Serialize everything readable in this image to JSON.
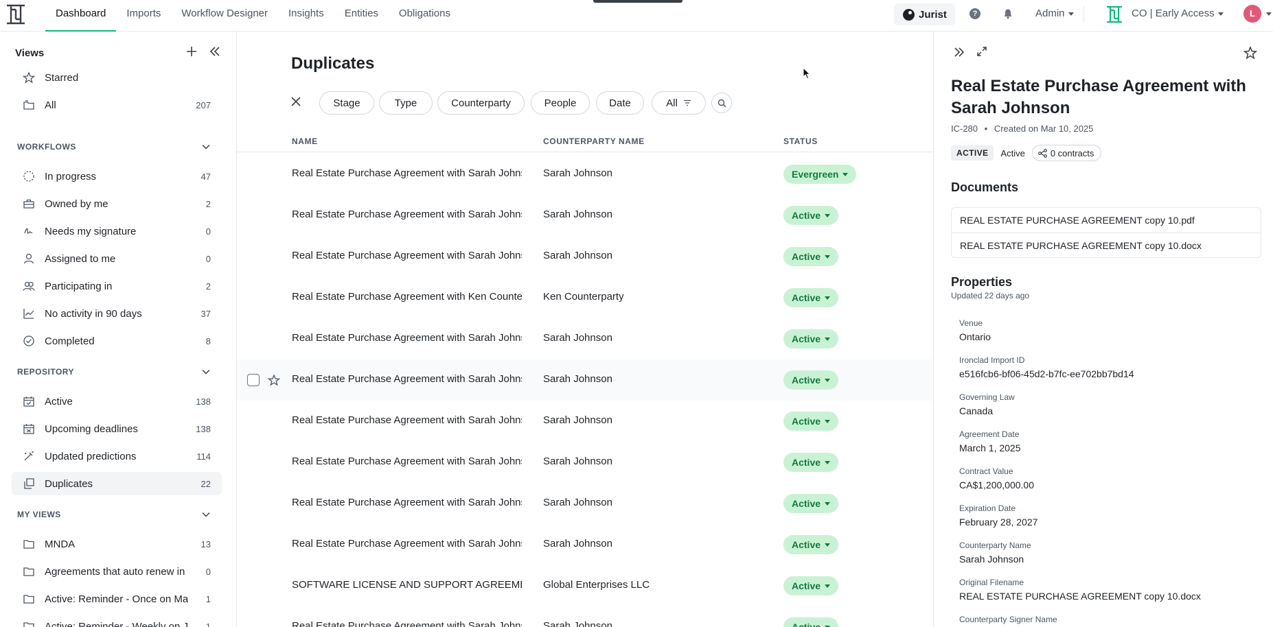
{
  "nav": {
    "links": [
      "Dashboard",
      "Imports",
      "Workflow Designer",
      "Insights",
      "Entities",
      "Obligations"
    ],
    "jurist_label": "Jurist",
    "help_glyph": "?",
    "admin_label": "Admin",
    "org_label": "CO | Early Access",
    "avatar_initial": "L",
    "accent_color": "#10b981"
  },
  "sidebar": {
    "views_title": "Views",
    "top_items": [
      {
        "label": "Starred",
        "count": ""
      },
      {
        "label": "All",
        "count": "207"
      }
    ],
    "workflows_title": "WORKFLOWS",
    "workflows": [
      {
        "label": "In progress",
        "count": "47"
      },
      {
        "label": "Owned by me",
        "count": "2"
      },
      {
        "label": "Needs my signature",
        "count": "0"
      },
      {
        "label": "Assigned to me",
        "count": "0"
      },
      {
        "label": "Participating in",
        "count": "2"
      },
      {
        "label": "No activity in 90 days",
        "count": "37"
      },
      {
        "label": "Completed",
        "count": "8"
      }
    ],
    "repository_title": "REPOSITORY",
    "repository": [
      {
        "label": "Active",
        "count": "138"
      },
      {
        "label": "Upcoming deadlines",
        "count": "138"
      },
      {
        "label": "Updated predictions",
        "count": "114"
      },
      {
        "label": "Duplicates",
        "count": "22"
      }
    ],
    "myviews_title": "MY VIEWS",
    "myviews": [
      {
        "label": "MNDA",
        "count": "13"
      },
      {
        "label": "Agreements that auto renew in",
        "count": "0"
      },
      {
        "label": "Active: Reminder - Once on Ma",
        "count": "1"
      },
      {
        "label": "Active: Reminder - Weekly on J",
        "count": "1"
      }
    ]
  },
  "main": {
    "title": "Duplicates",
    "filters": [
      "Stage",
      "Type",
      "Counterparty",
      "People",
      "Date",
      "All"
    ],
    "columns": {
      "name": "NAME",
      "counterparty": "COUNTERPARTY NAME",
      "status": "STATUS"
    },
    "rows": [
      {
        "name": "Real Estate Purchase Agreement with Sarah Johnson",
        "counterparty": "Sarah Johnson",
        "status": "Evergreen"
      },
      {
        "name": "Real Estate Purchase Agreement with Sarah Johnson",
        "counterparty": "Sarah Johnson",
        "status": "Active"
      },
      {
        "name": "Real Estate Purchase Agreement with Sarah Johnson",
        "counterparty": "Sarah Johnson",
        "status": "Active"
      },
      {
        "name": "Real Estate Purchase Agreement with Ken Counterparty",
        "counterparty": "Ken Counterparty",
        "status": "Active"
      },
      {
        "name": "Real Estate Purchase Agreement with Sarah Johnson",
        "counterparty": "Sarah Johnson",
        "status": "Active"
      },
      {
        "name": "Real Estate Purchase Agreement with Sarah Johnson",
        "counterparty": "Sarah Johnson",
        "status": "Active"
      },
      {
        "name": "Real Estate Purchase Agreement with Sarah Johnson",
        "counterparty": "Sarah Johnson",
        "status": "Active"
      },
      {
        "name": "Real Estate Purchase Agreement with Sarah Johnson",
        "counterparty": "Sarah Johnson",
        "status": "Active"
      },
      {
        "name": "Real Estate Purchase Agreement with Sarah Johnson",
        "counterparty": "Sarah Johnson",
        "status": "Active"
      },
      {
        "name": "Real Estate Purchase Agreement with Sarah Johnson",
        "counterparty": "Sarah Johnson",
        "status": "Active"
      },
      {
        "name": "SOFTWARE LICENSE AND SUPPORT AGREEMENT.docx",
        "counterparty": "Global Enterprises LLC",
        "status": "Active"
      },
      {
        "name": "Real Estate Purchase Agreement with Sarah Johnson",
        "counterparty": "Sarah Johnson",
        "status": "Active"
      }
    ],
    "status_bg": "#c9f2d5",
    "status_fg": "#137a3c"
  },
  "panel": {
    "title": "Real Estate Purchase Agreement with Sarah Johnson",
    "id": "IC-280",
    "created": "Created on Mar 10, 2025",
    "stage_badge": "ACTIVE",
    "status_text": "Active",
    "contracts": "0 contracts",
    "documents_title": "Documents",
    "documents": [
      "REAL ESTATE PURCHASE AGREEMENT copy 10.pdf",
      "REAL ESTATE PURCHASE AGREEMENT copy 10.docx"
    ],
    "properties_title": "Properties",
    "updated": "Updated 22 days ago",
    "properties": [
      {
        "label": "Venue",
        "value": "Ontario"
      },
      {
        "label": "Ironclad Import ID",
        "value": "e516fcb6-bf06-45d2-b7fc-ee702bb7bd14"
      },
      {
        "label": "Governing Law",
        "value": "Canada"
      },
      {
        "label": "Agreement Date",
        "value": "March 1, 2025"
      },
      {
        "label": "Contract Value",
        "value": "CA$1,200,000.00"
      },
      {
        "label": "Expiration Date",
        "value": "February 28, 2027"
      },
      {
        "label": "Counterparty Name",
        "value": "Sarah Johnson"
      },
      {
        "label": "Original Filename",
        "value": "REAL ESTATE PURCHASE AGREEMENT copy 10.docx"
      },
      {
        "label": "Counterparty Signer Name",
        "value": ""
      }
    ]
  }
}
